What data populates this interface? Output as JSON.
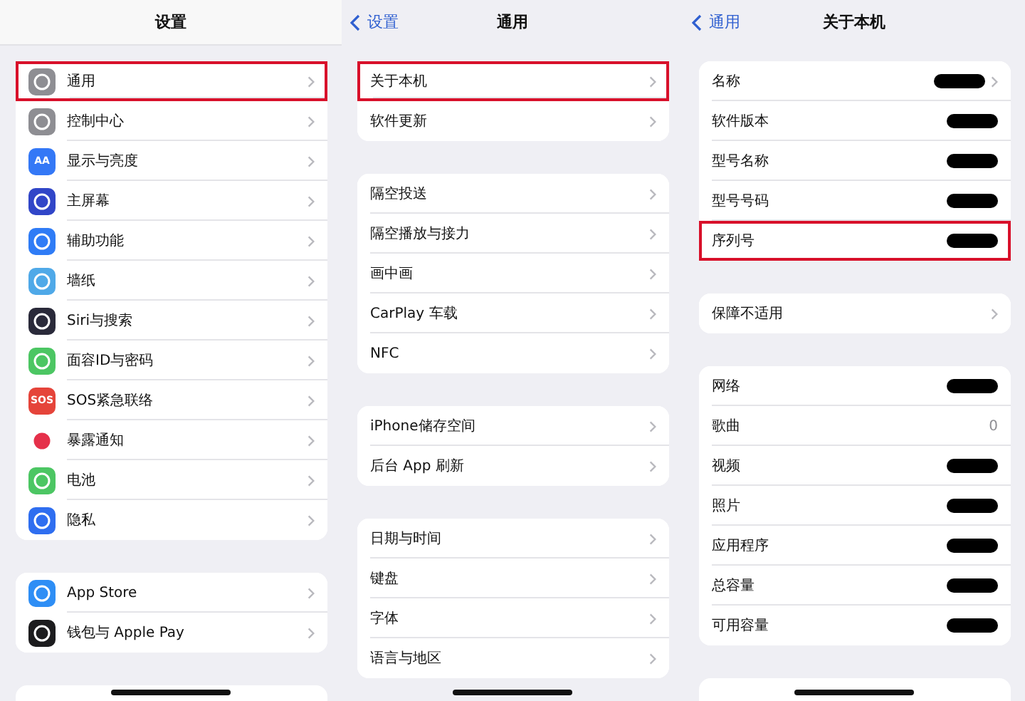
{
  "panels": [
    {
      "title": "设置",
      "groups": [
        {
          "kind": "list",
          "items": [
            {
              "label": "通用",
              "color": "#8e8e93",
              "highlighted": true,
              "kind": "link"
            },
            {
              "label": "控制中心",
              "color": "#8e8e93",
              "highlighted": false,
              "kind": "link"
            },
            {
              "label": "显示与亮度",
              "color": "#3478f6",
              "icon_text": "AA",
              "highlighted": false,
              "kind": "link"
            },
            {
              "label": "主屏幕",
              "color": "#3146c8",
              "highlighted": false,
              "kind": "link"
            },
            {
              "label": "辅助功能",
              "color": "#2f7cf6",
              "highlighted": false,
              "kind": "link"
            },
            {
              "label": "墙纸",
              "color": "#4fa9e8",
              "highlighted": false,
              "kind": "link"
            },
            {
              "label": "Siri与搜索",
              "color": "#2a2a3a",
              "highlighted": false,
              "kind": "link"
            },
            {
              "label": "面容ID与密码",
              "color": "#4cc663",
              "highlighted": false,
              "kind": "link"
            },
            {
              "label": "SOS紧急联络",
              "color": "#e5443a",
              "icon_text": "SOS",
              "highlighted": false,
              "kind": "link"
            },
            {
              "label": "暴露通知",
              "color": "#ffffff",
              "highlighted": false,
              "kind": "link"
            },
            {
              "label": "电池",
              "color": "#4cc663",
              "highlighted": false,
              "kind": "link"
            },
            {
              "label": "隐私",
              "color": "#2f6ef0",
              "highlighted": false,
              "kind": "link"
            }
          ]
        },
        {
          "kind": "list",
          "items": [
            {
              "label": "App Store",
              "color": "#2e8ef5",
              "highlighted": false,
              "kind": "link"
            },
            {
              "label": "钱包与 Apple Pay",
              "color": "#1c1c1e",
              "highlighted": false,
              "kind": "link"
            }
          ]
        },
        {
          "kind": "cut_off"
        }
      ]
    },
    {
      "title": "通用",
      "back": "设置",
      "groups": [
        {
          "kind": "list",
          "items": [
            {
              "label": "关于本机",
              "highlighted": true,
              "kind": "link"
            },
            {
              "label": "软件更新",
              "highlighted": false,
              "kind": "link"
            }
          ]
        },
        {
          "kind": "list",
          "items": [
            {
              "label": "隔空投送",
              "highlighted": false,
              "kind": "link"
            },
            {
              "label": "隔空播放与接力",
              "highlighted": false,
              "kind": "link"
            },
            {
              "label": "画中画",
              "highlighted": false,
              "kind": "link"
            },
            {
              "label": "CarPlay 车载",
              "highlighted": false,
              "kind": "link"
            },
            {
              "label": "NFC",
              "highlighted": false,
              "kind": "link"
            }
          ]
        },
        {
          "kind": "list",
          "items": [
            {
              "label": "iPhone储存空间",
              "highlighted": false,
              "kind": "link"
            },
            {
              "label": "后台 App 刷新",
              "highlighted": false,
              "kind": "link"
            }
          ]
        },
        {
          "kind": "list",
          "items": [
            {
              "label": "日期与时间",
              "highlighted": false,
              "kind": "link"
            },
            {
              "label": "键盘",
              "highlighted": false,
              "kind": "link"
            },
            {
              "label": "字体",
              "highlighted": false,
              "kind": "link"
            },
            {
              "label": "语言与地区",
              "highlighted": false,
              "kind": "link"
            }
          ]
        }
      ]
    },
    {
      "title": "关于本机",
      "back": "通用",
      "groups": [
        {
          "kind": "list",
          "items": [
            {
              "label": "名称",
              "highlighted": false,
              "kind": "redacted_link"
            },
            {
              "label": "软件版本",
              "highlighted": false,
              "kind": "redacted"
            },
            {
              "label": "型号名称",
              "highlighted": false,
              "kind": "redacted"
            },
            {
              "label": "型号号码",
              "highlighted": false,
              "kind": "redacted"
            },
            {
              "label": "序列号",
              "highlighted": true,
              "kind": "redacted"
            }
          ]
        },
        {
          "kind": "list",
          "items": [
            {
              "label": "保障不适用",
              "highlighted": false,
              "kind": "link"
            }
          ]
        },
        {
          "kind": "list",
          "items": [
            {
              "label": "网络",
              "highlighted": false,
              "kind": "redacted"
            },
            {
              "label": "歌曲",
              "highlighted": false,
              "kind": "text",
              "value": "0"
            },
            {
              "label": "视频",
              "highlighted": false,
              "kind": "redacted"
            },
            {
              "label": "照片",
              "highlighted": false,
              "kind": "redacted"
            },
            {
              "label": "应用程序",
              "highlighted": false,
              "kind": "redacted"
            },
            {
              "label": "总容量",
              "highlighted": false,
              "kind": "redacted"
            },
            {
              "label": "可用容量",
              "highlighted": false,
              "kind": "redacted"
            }
          ]
        },
        {
          "kind": "cut_off"
        }
      ]
    }
  ]
}
